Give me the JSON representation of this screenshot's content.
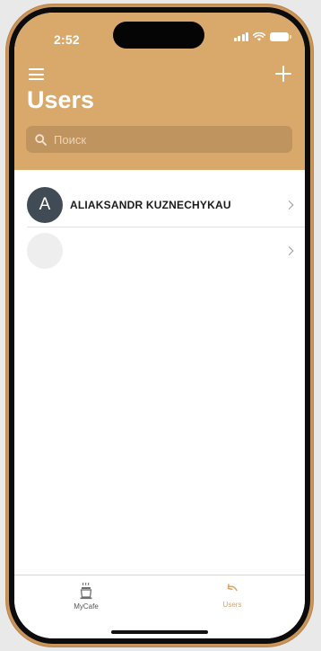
{
  "status_bar": {
    "time": "2:52"
  },
  "header": {
    "title": "Users",
    "search_placeholder": "Поиск"
  },
  "users": [
    {
      "initial": "A",
      "name": "ALIAKSANDR KUZNECHYKAU"
    },
    {
      "initial": "",
      "name": ""
    }
  ],
  "tabbar": {
    "tabs": [
      {
        "label": "MyCafe",
        "icon": "coffee-cup-icon",
        "active": false
      },
      {
        "label": "Users",
        "icon": "undo-arrow-icon",
        "active": true
      }
    ]
  },
  "colors": {
    "header_bg": "#d9a86b",
    "search_bg": "#bf945e",
    "avatar_bg": "#414b55",
    "active_tab": "#d4a266",
    "phone_frame": "#c9955a"
  }
}
